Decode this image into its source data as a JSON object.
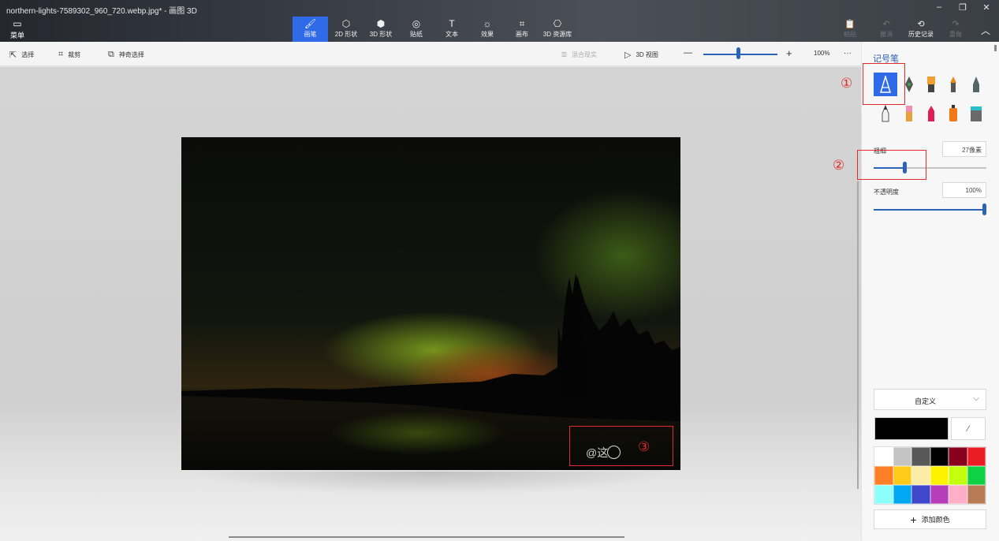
{
  "window": {
    "title": "northern-lights-7589302_960_720.webp.jpg* - 画图 3D",
    "controls": [
      "–",
      "❐",
      "✕"
    ]
  },
  "ribbon": {
    "menu_label": "菜单",
    "tools": [
      {
        "label": "画笔",
        "icon": "brush-icon",
        "glyph": "🖌"
      },
      {
        "label": "2D 形状",
        "icon": "2d-shapes-icon",
        "glyph": "⬡"
      },
      {
        "label": "3D 形状",
        "icon": "3d-shapes-icon",
        "glyph": "⬢"
      },
      {
        "label": "贴纸",
        "icon": "sticker-icon",
        "glyph": "◎"
      },
      {
        "label": "文本",
        "icon": "text-icon",
        "glyph": "T"
      },
      {
        "label": "效果",
        "icon": "effects-icon",
        "glyph": "☼"
      },
      {
        "label": "画布",
        "icon": "canvas-icon",
        "glyph": "⌗"
      },
      {
        "label": "3D 资源库",
        "icon": "3d-library-icon",
        "glyph": "⎔"
      }
    ],
    "right": [
      {
        "label": "粘贴",
        "glyph": "📋"
      },
      {
        "label": "撤消",
        "glyph": "↶"
      },
      {
        "label": "历史记录",
        "glyph": "⟲"
      },
      {
        "label": "重做",
        "glyph": "↷"
      }
    ],
    "collapse_glyph": "︿"
  },
  "toolbar": {
    "select": "选择",
    "crop": "裁剪",
    "magic_select": "神奇选择",
    "mixed_reality": "混合现实",
    "view3d": "3D 视图",
    "zoom_minus": "—",
    "zoom_plus": "+",
    "zoom_value": "100%",
    "zoom_level": 0.47,
    "more": "···"
  },
  "canvas": {
    "watermark": "@这"
  },
  "annotations": [
    "①",
    "②",
    "③"
  ],
  "panel": {
    "title": "记号笔",
    "brushes": [
      {
        "name": "marker",
        "selected": true
      },
      {
        "name": "calligraphy-pen"
      },
      {
        "name": "oil-brush"
      },
      {
        "name": "watercolor"
      },
      {
        "name": "pixel-pen"
      },
      {
        "name": "pencil"
      },
      {
        "name": "eraser"
      },
      {
        "name": "crayon"
      },
      {
        "name": "spray-can"
      },
      {
        "name": "fill"
      }
    ],
    "thickness_label": "粗细",
    "thickness_value": "27像素",
    "thickness_level": 0.27,
    "opacity_label": "不透明度",
    "opacity_value": "100%",
    "opacity_level": 1.0,
    "palette_mode": "自定义",
    "current_color": "#000000",
    "swatches": [
      "#ffffff",
      "#c3c3c3",
      "#585858",
      "#000000",
      "#88001b",
      "#ec1c24",
      "#ff7f27",
      "#ffca18",
      "#fdeca6",
      "#fff200",
      "#c4ff0e",
      "#0ed145",
      "#8cfffb",
      "#00a8f3",
      "#3f48cc",
      "#b83dba",
      "#ffaec8",
      "#b97a56"
    ],
    "add_color": "添加颜色"
  }
}
